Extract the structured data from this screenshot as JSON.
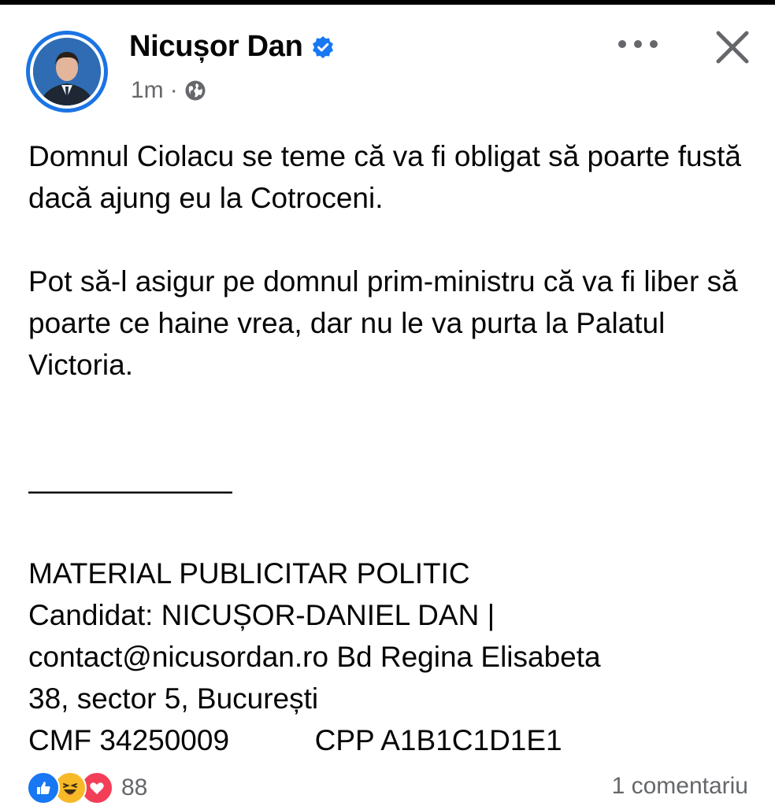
{
  "post": {
    "author": "Nicușor Dan",
    "time": "1m",
    "separator": "·",
    "paragraphs": [
      "Domnul Ciolacu se teme că va fi obligat să poarte fustă dacă ajung eu la Cotroceni.",
      "Pot să-l asigur pe domnul prim-ministru că va fi liber să poarte ce haine vrea, dar nu le va purta la Palatul Victoria."
    ],
    "divider": "———————",
    "disclaimer": {
      "line1": "MATERIAL PUBLICITAR POLITIC",
      "line2": "Candidat: NICUȘOR-DANIEL DAN |",
      "line3": "contact@nicusordan.ro Bd Regina Elisabeta",
      "line4": "38, sector 5, București",
      "cmf": "CMF 34250009",
      "cpp": "CPP A1B1C1D1E1"
    },
    "reactions": {
      "icons": [
        "like-icon",
        "haha-icon",
        "love-icon"
      ],
      "count": "88"
    },
    "comments": "1 comentariu"
  },
  "colors": {
    "accent": "#1877f2",
    "secondary_text": "#65676b",
    "primary_text": "#050505"
  }
}
